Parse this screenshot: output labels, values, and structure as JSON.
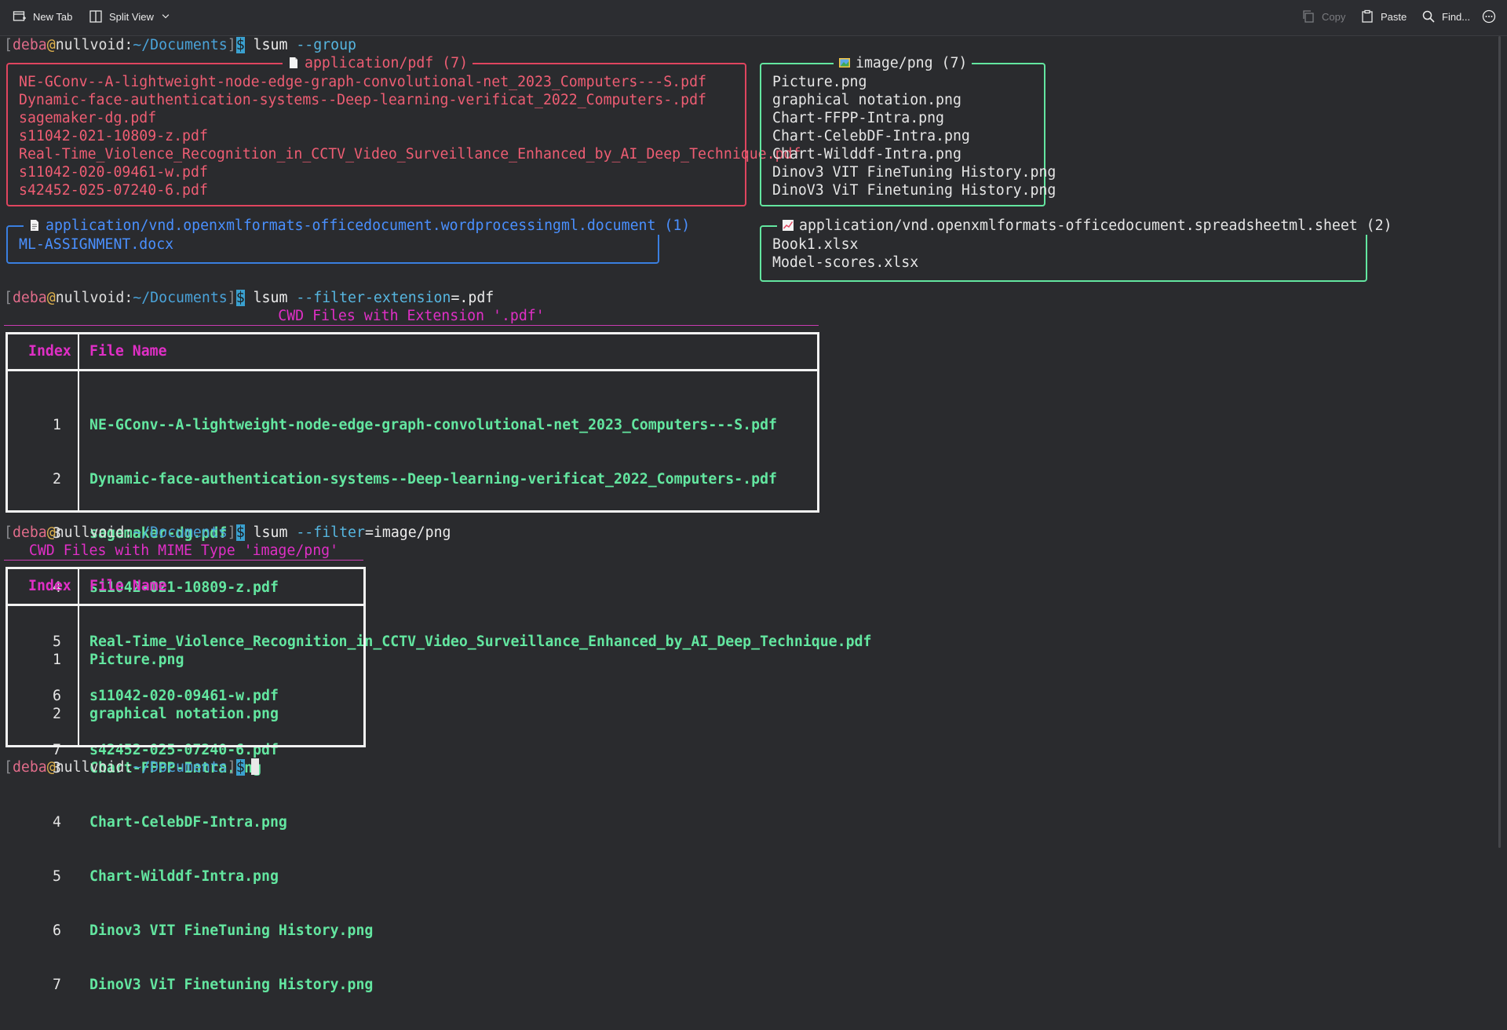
{
  "toolbar": {
    "new_tab": "New Tab",
    "split_view": "Split View",
    "copy": "Copy",
    "paste": "Paste",
    "find": "Find..."
  },
  "prompt": {
    "user": "deba",
    "at": "@",
    "host": "nullvoid",
    "colon": ":",
    "path": "~/Documents",
    "open": "[",
    "close": "]",
    "dollar": "$"
  },
  "commands": [
    {
      "cmd": "lsum",
      "flag": "--group",
      "arg": ""
    },
    {
      "cmd": "lsum",
      "flag": "--filter-extension",
      "arg": "=.pdf"
    },
    {
      "cmd": "lsum",
      "flag": "--filter",
      "arg": "=image/png"
    }
  ],
  "groups": {
    "pdf": {
      "title": "application/pdf (7)",
      "icon": "document-icon",
      "items": [
        "NE-GConv--A-lightweight-node-edge-graph-convolutional-net_2023_Computers---S.pdf",
        "Dynamic-face-authentication-systems--Deep-learning-verificat_2022_Computers-.pdf",
        "sagemaker-dg.pdf",
        "s11042-021-10809-z.pdf",
        "Real-Time_Violence_Recognition_in_CCTV_Video_Surveillance_Enhanced_by_AI_Deep_Technique.pdf",
        "s11042-020-09461-w.pdf",
        "s42452-025-07240-6.pdf"
      ]
    },
    "png": {
      "title": "image/png (7)",
      "icon": "image-icon",
      "items": [
        "Picture.png",
        "graphical notation.png",
        "Chart-FFPP-Intra.png",
        "Chart-CelebDF-Intra.png",
        "Chart-Wilddf-Intra.png",
        "Dinov3 VIT FineTuning History.png",
        "DinoV3 ViT Finetuning History.png"
      ]
    },
    "docx": {
      "title": "application/vnd.openxmlformats-officedocument.wordprocessingml.document (1)",
      "icon": "word-document-icon",
      "items": [
        "ML-ASSIGNMENT.docx"
      ]
    },
    "xlsx": {
      "title": "application/vnd.openxmlformats-officedocument.spreadsheetml.sheet (2)",
      "icon": "spreadsheet-chart-icon",
      "items": [
        "Book1.xlsx",
        "Model-scores.xlsx"
      ]
    }
  },
  "pdf_table": {
    "title": "CWD Files with Extension '.pdf'",
    "headers": [
      "Index",
      "File Name"
    ],
    "rows": [
      {
        "index": "1",
        "name": "NE-GConv--A-lightweight-node-edge-graph-convolutional-net_2023_Computers---S.pdf"
      },
      {
        "index": "2",
        "name": "Dynamic-face-authentication-systems--Deep-learning-verificat_2022_Computers-.pdf"
      },
      {
        "index": "3",
        "name": "sagemaker-dg.pdf"
      },
      {
        "index": "4",
        "name": "s11042-021-10809-z.pdf"
      },
      {
        "index": "5",
        "name": "Real-Time_Violence_Recognition_in_CCTV_Video_Surveillance_Enhanced_by_AI_Deep_Technique.pdf"
      },
      {
        "index": "6",
        "name": "s11042-020-09461-w.pdf"
      },
      {
        "index": "7",
        "name": "s42452-025-07240-6.pdf"
      }
    ]
  },
  "png_table": {
    "title": "CWD Files with MIME Type 'image/png'",
    "headers": [
      "Index",
      "File Name"
    ],
    "rows": [
      {
        "index": "1",
        "name": "Picture.png"
      },
      {
        "index": "2",
        "name": "graphical notation.png"
      },
      {
        "index": "3",
        "name": "Chart-FFPP-Intra.png"
      },
      {
        "index": "4",
        "name": "Chart-CelebDF-Intra.png"
      },
      {
        "index": "5",
        "name": "Chart-Wilddf-Intra.png"
      },
      {
        "index": "6",
        "name": "Dinov3 VIT FineTuning History.png"
      },
      {
        "index": "7",
        "name": "DinoV3 ViT Finetuning History.png"
      }
    ]
  }
}
